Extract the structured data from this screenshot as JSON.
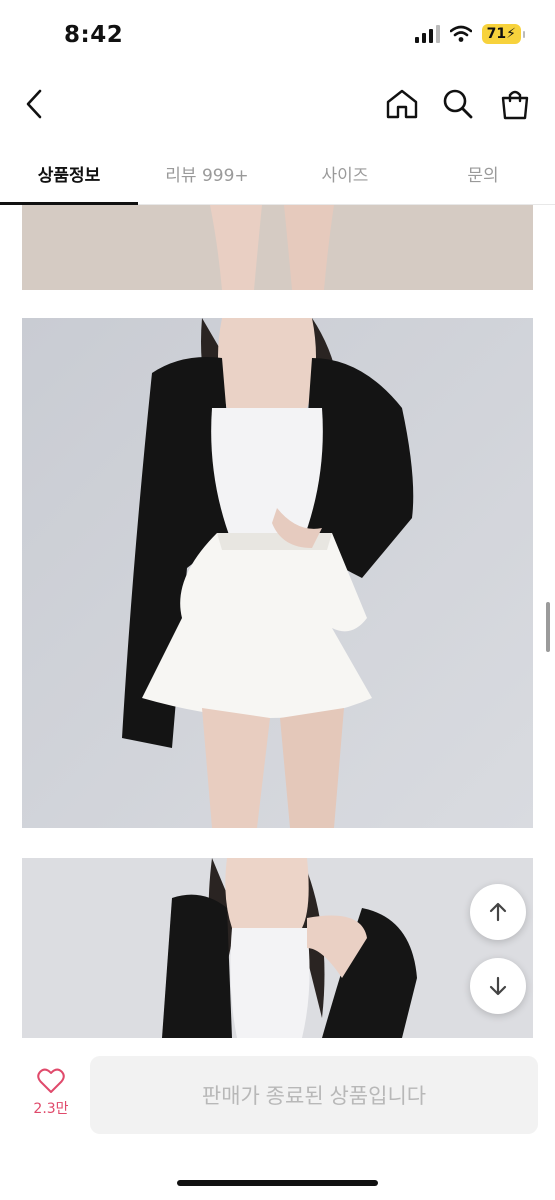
{
  "status_bar": {
    "time": "8:42",
    "battery": "71"
  },
  "nav": {
    "back_icon": "chevron-left-icon",
    "home_icon": "home-icon",
    "search_icon": "search-icon",
    "cart_icon": "shopping-bag-icon"
  },
  "tabs": [
    {
      "label": "상품정보",
      "active": true
    },
    {
      "label": "리뷰 999+",
      "active": false
    },
    {
      "label": "사이즈",
      "active": false
    },
    {
      "label": "문의",
      "active": false
    }
  ],
  "fabs": {
    "up_icon": "arrow-up-icon",
    "down_icon": "arrow-down-icon"
  },
  "bottom": {
    "like_icon": "heart-outline-icon",
    "like_count": "2.3만",
    "buy_label": "판매가 종료된 상품입니다"
  },
  "colors": {
    "accent": "#e04a6b",
    "battery": "#f7d23c"
  }
}
